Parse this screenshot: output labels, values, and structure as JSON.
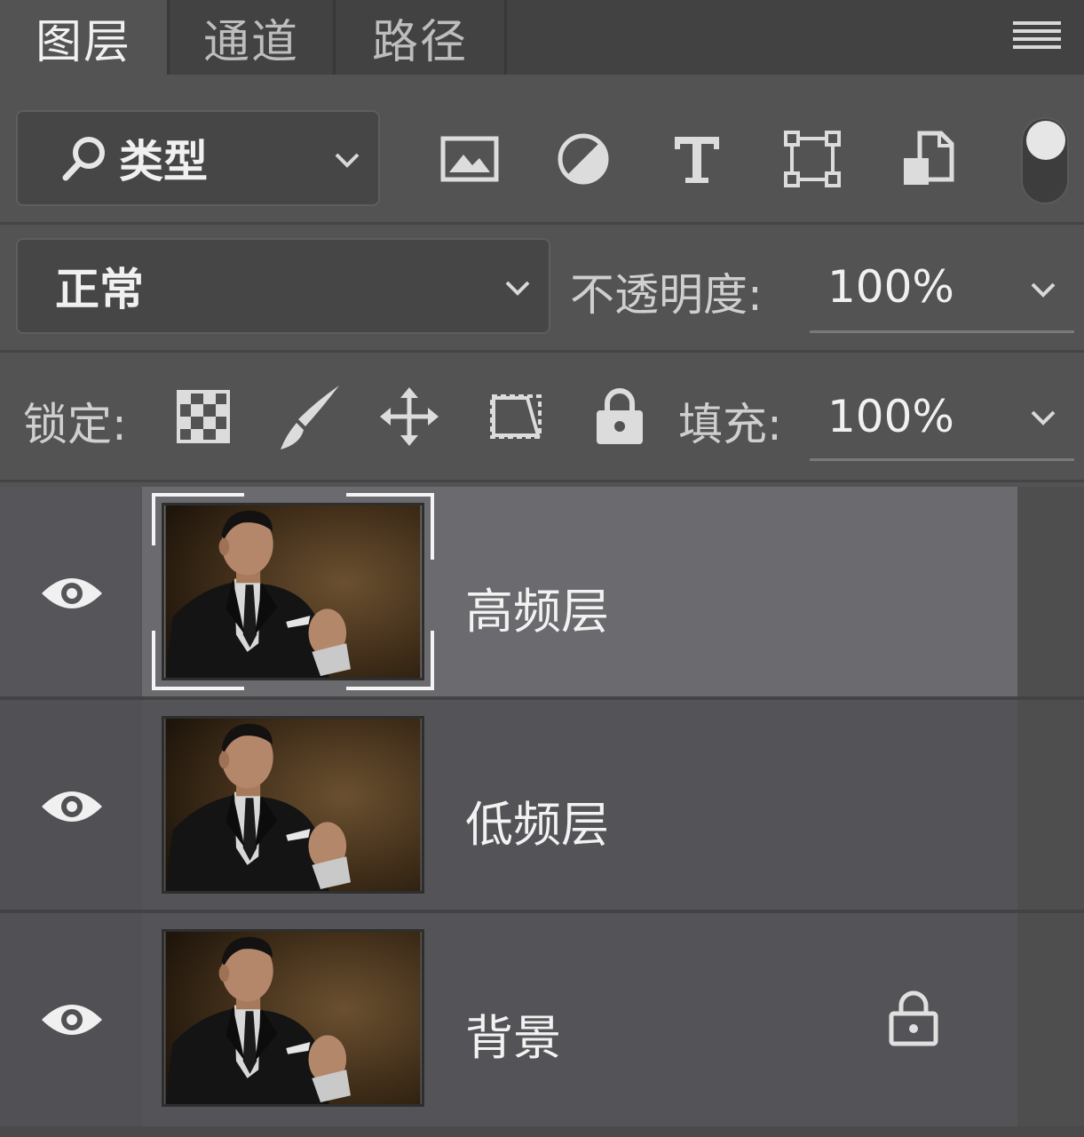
{
  "tabs": [
    {
      "label": "图层",
      "active": true
    },
    {
      "label": "通道",
      "active": false
    },
    {
      "label": "路径",
      "active": false
    }
  ],
  "filter": {
    "kind_label": "类型",
    "icons": [
      "image-filter-icon",
      "adjustment-filter-icon",
      "type-filter-icon",
      "shape-filter-icon",
      "smart-object-filter-icon"
    ]
  },
  "blend": {
    "mode": "正常",
    "opacity_label": "不透明度:",
    "opacity_value": "100%"
  },
  "lock": {
    "label": "锁定:",
    "fill_label": "填充:",
    "fill_value": "100%"
  },
  "layers": [
    {
      "name": "高频层",
      "selected": true,
      "locked": false
    },
    {
      "name": "低频层",
      "selected": false,
      "locked": false
    },
    {
      "name": "背景",
      "selected": false,
      "locked": true
    }
  ],
  "colors": {
    "panel": "#535353",
    "selected_row": "#6b6a6e",
    "row": "#545357"
  }
}
